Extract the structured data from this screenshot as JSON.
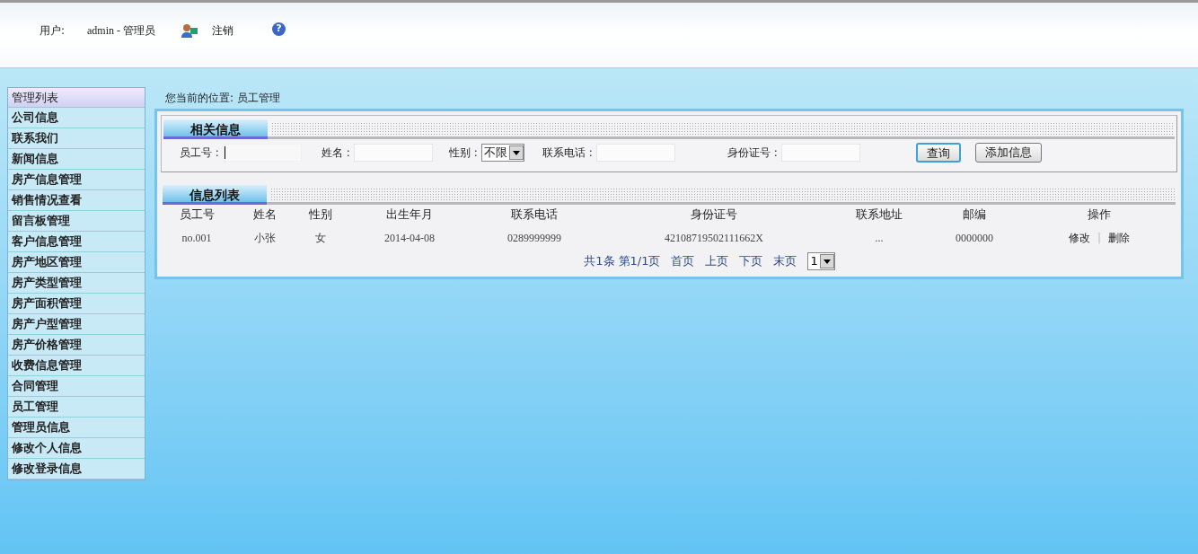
{
  "header": {
    "user_label": "用户:",
    "user_value": "admin - 管理员",
    "logout": "注销",
    "help": "?"
  },
  "sidebar": {
    "title": "管理列表",
    "items": [
      {
        "label": "公司信息",
        "selected": false
      },
      {
        "label": "联系我们",
        "selected": false
      },
      {
        "label": "新闻信息",
        "selected": false
      },
      {
        "label": "房产信息管理",
        "selected": false
      },
      {
        "label": "销售情况查看",
        "selected": false
      },
      {
        "label": "留言板管理",
        "selected": false
      },
      {
        "label": "客户信息管理",
        "selected": false
      },
      {
        "label": "房产地区管理",
        "selected": false
      },
      {
        "label": "房产类型管理",
        "selected": false
      },
      {
        "label": "房产面积管理",
        "selected": false
      },
      {
        "label": "房产户型管理",
        "selected": false
      },
      {
        "label": "房产价格管理",
        "selected": false
      },
      {
        "label": "收费信息管理",
        "selected": false
      },
      {
        "label": "合同管理",
        "selected": false
      },
      {
        "label": "员工管理",
        "selected": false
      },
      {
        "label": "管理员信息",
        "selected": false
      },
      {
        "label": "修改个人信息",
        "selected": false
      },
      {
        "label": "修改登录信息",
        "selected": false
      }
    ]
  },
  "breadcrumb": "您当前的位置:  员工管理",
  "search_panel": {
    "title": "相关信息",
    "fields": [
      {
        "kind": "input",
        "label": "员工号 :",
        "focused": true
      },
      {
        "kind": "input",
        "label": "姓名 :",
        "focused": false
      },
      {
        "kind": "select",
        "label": "性别 :",
        "value": "不限"
      },
      {
        "kind": "input",
        "label": "联系电话 :",
        "focused": false
      },
      {
        "kind": "input",
        "label": "身份证号 :",
        "focused": false
      }
    ],
    "buttons": [
      {
        "label": "查询",
        "focused": true
      },
      {
        "label": "添加信息",
        "focused": false
      }
    ]
  },
  "list_panel": {
    "title": "信息列表",
    "table": {
      "columns": [
        "员工号",
        "姓名",
        "性别",
        "出生年月",
        "联系电话",
        "身份证号",
        "联系地址",
        "邮编",
        "操作"
      ],
      "rows": [
        {
          "cells": [
            "no.001",
            "小张",
            "女",
            "2014-04-08",
            "0289999999",
            "42108719502111662X",
            "...",
            "0000000"
          ],
          "actions": [
            "修改",
            "删除"
          ],
          "separator": "|"
        }
      ]
    },
    "pagination": {
      "total": "共1条",
      "page": "第1/1页",
      "links": [
        "首页",
        "上页",
        "下页",
        "末页"
      ],
      "page_select": "1"
    }
  }
}
